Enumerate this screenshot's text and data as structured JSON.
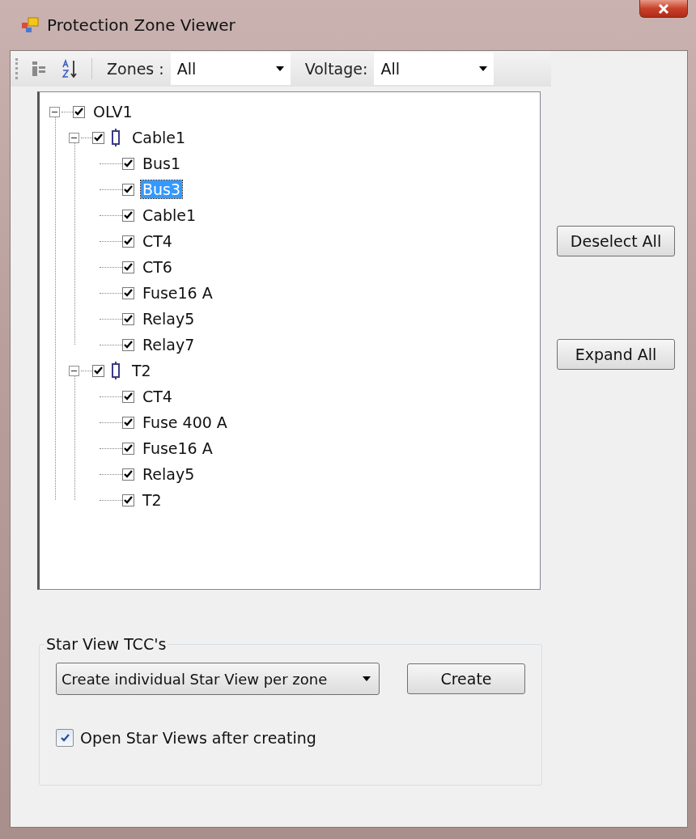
{
  "window": {
    "title": "Protection Zone Viewer"
  },
  "toolbar": {
    "zones_label": "Zones :",
    "zones_value": "All",
    "voltage_label": "Voltage:",
    "voltage_value": "All"
  },
  "tree": [
    {
      "label": "OLV1",
      "checked": true,
      "expanded": true,
      "selected": false,
      "children": [
        {
          "label": "Cable1",
          "kind": "zone",
          "checked": true,
          "expanded": true,
          "selected": false,
          "children": [
            {
              "label": "Bus1",
              "checked": true,
              "selected": false
            },
            {
              "label": "Bus3",
              "checked": true,
              "selected": true
            },
            {
              "label": "Cable1",
              "checked": true,
              "selected": false
            },
            {
              "label": "CT4",
              "checked": true,
              "selected": false
            },
            {
              "label": "CT6",
              "checked": true,
              "selected": false
            },
            {
              "label": "Fuse16 A",
              "checked": true,
              "selected": false
            },
            {
              "label": "Relay5",
              "checked": true,
              "selected": false
            },
            {
              "label": "Relay7",
              "checked": true,
              "selected": false
            }
          ]
        },
        {
          "label": "T2",
          "kind": "zone",
          "checked": true,
          "expanded": true,
          "selected": false,
          "children": [
            {
              "label": "CT4",
              "checked": true,
              "selected": false
            },
            {
              "label": "Fuse 400 A",
              "checked": true,
              "selected": false
            },
            {
              "label": "Fuse16 A",
              "checked": true,
              "selected": false
            },
            {
              "label": "Relay5",
              "checked": true,
              "selected": false
            },
            {
              "label": "T2",
              "checked": true,
              "selected": false
            }
          ]
        }
      ]
    }
  ],
  "buttons": [
    "Deselect All",
    "Expand All"
  ],
  "star_view": {
    "title": "Star View TCC's",
    "mode": "Create individual Star View per zone",
    "create_button": "Create",
    "open_after": {
      "label": "Open Star Views after creating",
      "checked": true
    }
  }
}
